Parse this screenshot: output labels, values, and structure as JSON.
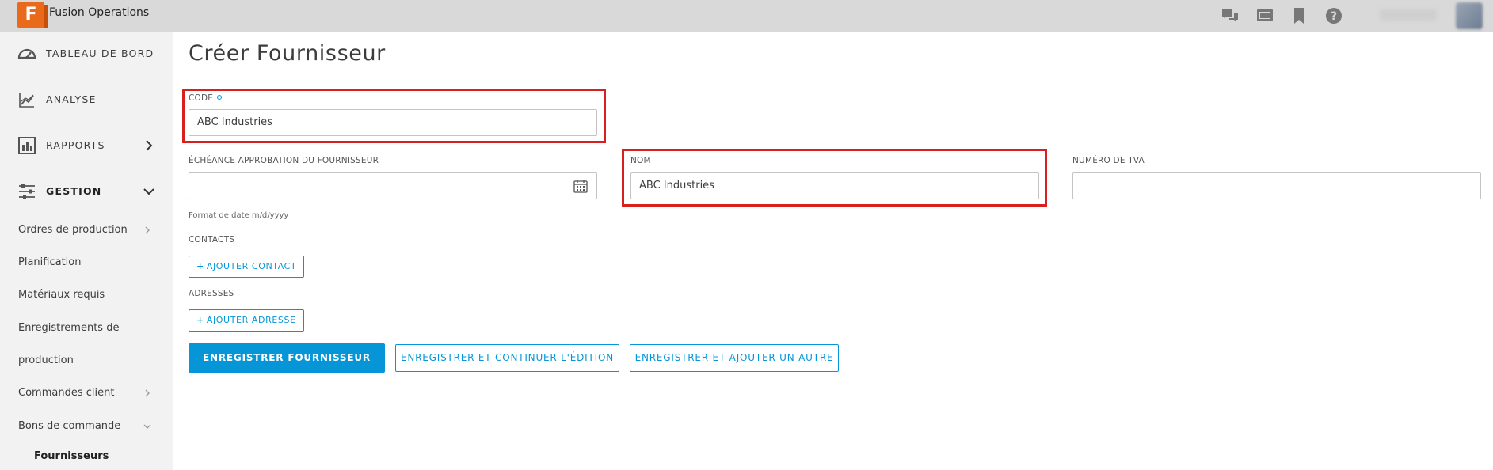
{
  "app": {
    "logo_letter": "F",
    "title": "Fusion Operations"
  },
  "topbar": {
    "icons": [
      "chat-icon",
      "screen-icon",
      "bookmark-icon",
      "help-icon"
    ]
  },
  "sidebar": {
    "main_items": [
      {
        "label": "TABLEAU DE BORD",
        "icon": "dashboard-icon"
      },
      {
        "label": "ANALYSE",
        "icon": "analytics-icon"
      },
      {
        "label": "RAPPORTS",
        "icon": "reports-icon"
      },
      {
        "label": "GESTION",
        "icon": "management-icon"
      }
    ],
    "sub_items": [
      {
        "label": "Ordres de production"
      },
      {
        "label": "Planification"
      },
      {
        "label": "Matériaux requis"
      },
      {
        "label": "Enregistrements de"
      },
      {
        "label": "production"
      },
      {
        "label": "Commandes client"
      },
      {
        "label": "Bons de commande"
      }
    ],
    "leaf_item": "Fournisseurs"
  },
  "page": {
    "title": "Créer Fournisseur",
    "code": {
      "label": "CODE",
      "value": "ABC Industries"
    },
    "deadline": {
      "label": "ÉCHÉANCE APPROBATION DU FOURNISSEUR",
      "value": "",
      "hint": "Format de date m/d/yyyy"
    },
    "name": {
      "label": "NOM",
      "value": "ABC Industries"
    },
    "vat": {
      "label": "NUMÉRO DE TVA",
      "value": ""
    },
    "contacts": {
      "label": "CONTACTS",
      "button": "AJOUTER CONTACT"
    },
    "addresses": {
      "label": "ADRESSES",
      "button": "AJOUTER ADRESSE"
    },
    "actions": {
      "save": "ENREGISTRER FOURNISSEUR",
      "save_continue": "ENREGISTRER ET CONTINUER L'ÉDITION",
      "save_add": "ENREGISTRER ET AJOUTER UN AUTRE"
    }
  },
  "colors": {
    "accent": "#0696d7",
    "highlight": "#d8201f",
    "logo": "#ea6a1c"
  }
}
